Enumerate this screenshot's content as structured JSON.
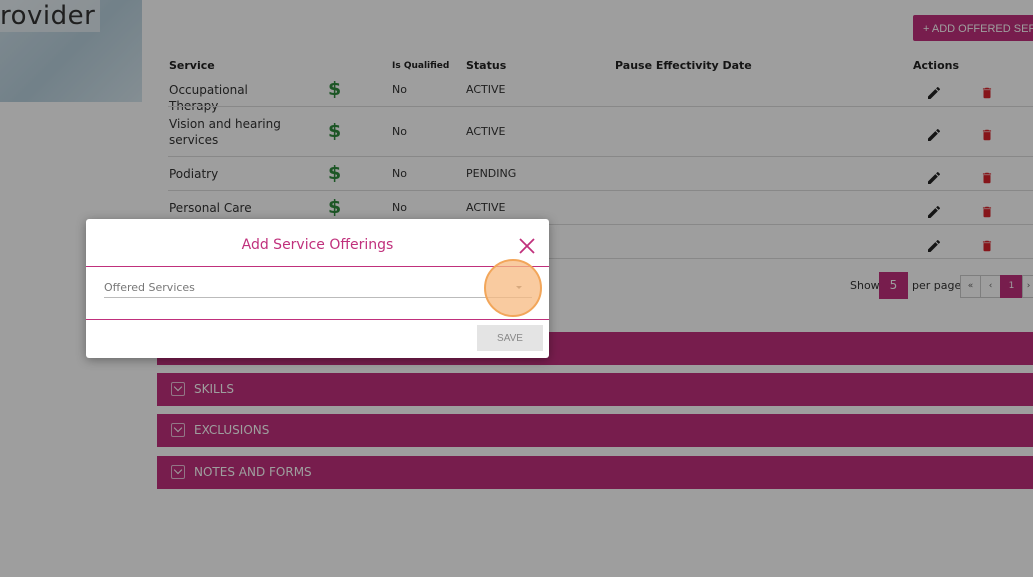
{
  "header": {
    "provider_title": "rovider",
    "add_button_label": "+ ADD OFFERED SERVICE"
  },
  "table": {
    "columns": {
      "service": "Service",
      "is_qualified": "Is Qualified",
      "status": "Status",
      "pause_date": "Pause Effectivity Date",
      "actions": "Actions"
    },
    "rows": [
      {
        "service": "Occupational Therapy",
        "qualified": "No",
        "status": "ACTIVE"
      },
      {
        "service": "Vision and hearing services",
        "qualified": "No",
        "status": "ACTIVE"
      },
      {
        "service": "Podiatry",
        "qualified": "No",
        "status": "PENDING"
      },
      {
        "service": "Personal Care",
        "qualified": "No",
        "status": "ACTIVE"
      }
    ],
    "dollar_symbol": "$"
  },
  "pagination": {
    "show_label": "Show",
    "per_page_value": "5",
    "per_page_label": "per page",
    "first": "«",
    "prev": "‹",
    "current_page": "1",
    "next": "›"
  },
  "sections": [
    {
      "label": ""
    },
    {
      "label": "SKILLS"
    },
    {
      "label": "EXCLUSIONS"
    },
    {
      "label": "NOTES AND FORMS"
    }
  ],
  "modal": {
    "title": "Add Service Offerings",
    "select_placeholder": "Offered Services",
    "save_label": "SAVE"
  },
  "colors": {
    "accent": "#c0307c",
    "dollar": "#2e8b3d",
    "delete": "#d9232b",
    "click_marker": "#f2a65a"
  },
  "icons": [
    "edit-icon",
    "delete-icon",
    "close-icon",
    "chevron-down-icon",
    "dollar-icon"
  ]
}
